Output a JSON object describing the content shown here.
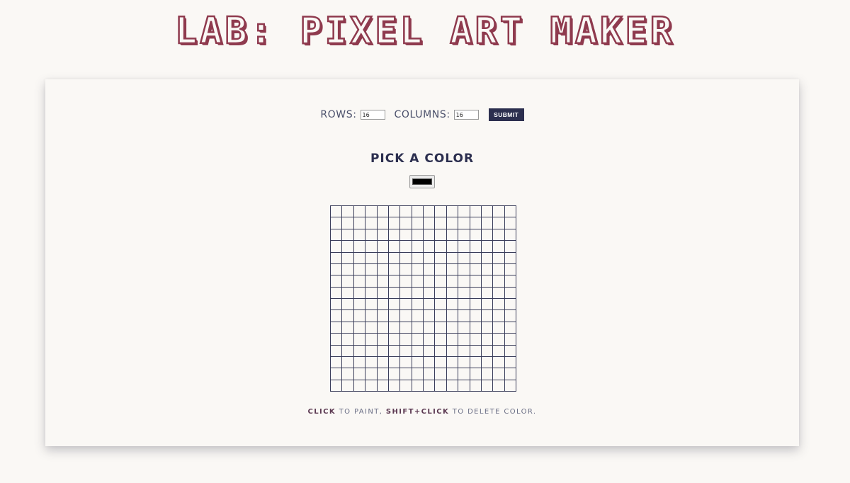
{
  "title": "LAB: PIXEL ART MAKER",
  "size_form": {
    "rows_label": "ROWS:",
    "rows_value": "16",
    "columns_label": "COLUMNS:",
    "columns_value": "16",
    "submit_label": "SUBMIT"
  },
  "color_section": {
    "heading": "PICK A COLOR",
    "selected_color": "#000000"
  },
  "grid": {
    "rows": 16,
    "columns": 16
  },
  "instructions": {
    "click_key": "CLICK",
    "click_text": " TO PAINT, ",
    "shift_key": "SHIFT+CLICK",
    "shift_text": " TO DELETE COLOR."
  },
  "colors": {
    "title_color": "#8f3a4e",
    "accent": "#2c2f4f",
    "background": "#faf8f5"
  }
}
